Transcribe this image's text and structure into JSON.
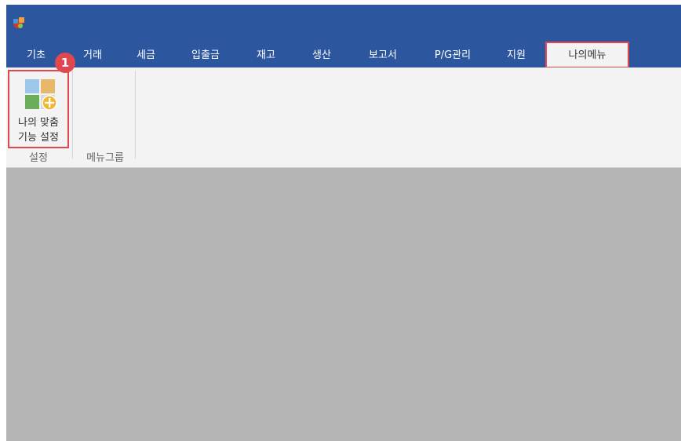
{
  "app": {
    "icon": "app-logo-icon"
  },
  "tabs": [
    {
      "label": "기초"
    },
    {
      "label": "거래"
    },
    {
      "label": "세금"
    },
    {
      "label": "입출금"
    },
    {
      "label": "재고"
    },
    {
      "label": "생산"
    },
    {
      "label": "보고서"
    },
    {
      "label": "P/G관리"
    },
    {
      "label": "지원"
    },
    {
      "label": "나의메뉴",
      "active": true
    }
  ],
  "ribbon": {
    "button": {
      "line1": "나의 맞춤",
      "line2": "기능 설정",
      "icon": "grid-add-icon"
    },
    "groups": [
      {
        "label": "설정"
      },
      {
        "label": "메뉴그룹"
      }
    ]
  },
  "annotation": {
    "step": "1"
  },
  "colors": {
    "titlebar": "#2c579f",
    "ribbon": "#f3f3f3",
    "workspace": "#b4b4b4",
    "highlight": "#e0474f"
  }
}
